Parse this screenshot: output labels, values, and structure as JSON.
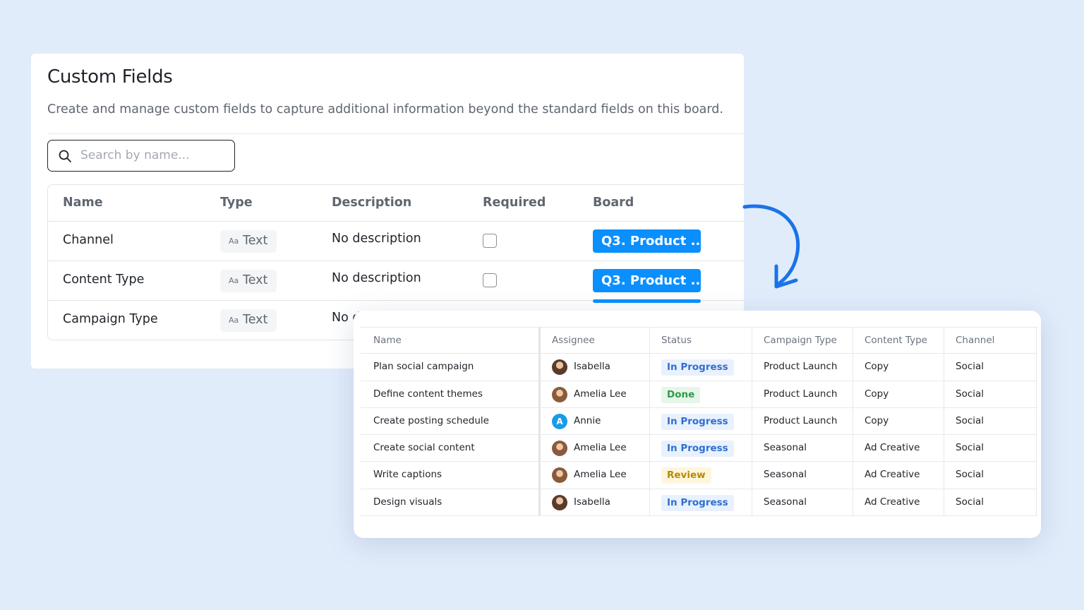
{
  "custom_fields": {
    "title": "Custom Fields",
    "description": "Create and manage custom fields to capture additional information beyond the standard fields on this board.",
    "search": {
      "placeholder": "Search by name..."
    },
    "columns": {
      "name": "Name",
      "type": "Type",
      "description": "Description",
      "required": "Required",
      "board": "Board"
    },
    "rows": [
      {
        "name": "Channel",
        "type_icon": "Aa",
        "type": "Text",
        "description": "No description",
        "board": "Q3. Product ..."
      },
      {
        "name": "Content Type",
        "type_icon": "Aa",
        "type": "Text",
        "description": "No description",
        "board": "Q3. Product ..."
      },
      {
        "name": "Campaign Type",
        "type_icon": "Aa",
        "type": "Text",
        "description": "No d",
        "board": ""
      }
    ]
  },
  "board_table": {
    "columns": [
      "Name",
      "Assignee",
      "Status",
      "Campaign Type",
      "Content Type",
      "Channel"
    ],
    "rows": [
      {
        "name": "Plan social campaign",
        "assignee": "Isabella",
        "avatar": "photo",
        "status": "In Progress",
        "status_kind": "progress",
        "campaign_type": "Product Launch",
        "content_type": "Copy",
        "channel": "Social"
      },
      {
        "name": "Define content themes",
        "assignee": "Amelia Lee",
        "avatar": "photo2",
        "status": "Done",
        "status_kind": "done",
        "campaign_type": "Product Launch",
        "content_type": "Copy",
        "channel": "Social"
      },
      {
        "name": "Create posting schedule",
        "assignee": "Annie",
        "avatar": "A",
        "status": "In Progress",
        "status_kind": "progress",
        "campaign_type": "Product Launch",
        "content_type": "Copy",
        "channel": "Social"
      },
      {
        "name": "Create social content",
        "assignee": "Amelia Lee",
        "avatar": "photo2",
        "status": "In Progress",
        "status_kind": "progress",
        "campaign_type": "Seasonal",
        "content_type": "Ad Creative",
        "channel": "Social"
      },
      {
        "name": "Write captions",
        "assignee": "Amelia Lee",
        "avatar": "photo2",
        "status": "Review",
        "status_kind": "review",
        "campaign_type": "Seasonal",
        "content_type": "Ad Creative",
        "channel": "Social"
      },
      {
        "name": "Design visuals",
        "assignee": "Isabella",
        "avatar": "photo",
        "status": "In Progress",
        "status_kind": "progress",
        "campaign_type": "Seasonal",
        "content_type": "Ad Creative",
        "channel": "Social"
      }
    ]
  },
  "colors": {
    "background": "#e1ecfb",
    "accent": "#0a8fff",
    "arrow": "#1a73e8"
  },
  "icons": {
    "search": "search-icon",
    "arrow": "curved-arrow-icon"
  }
}
